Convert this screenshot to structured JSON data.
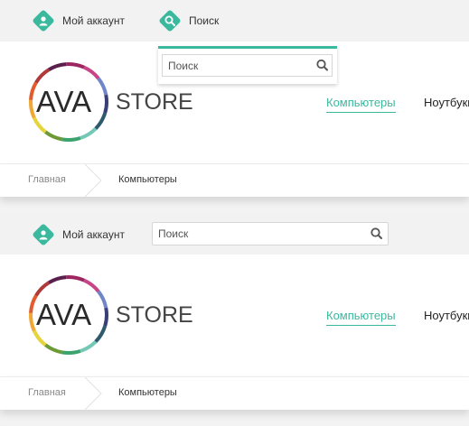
{
  "screens": [
    {
      "topbar": {
        "account_label": "Мой аккаунт",
        "search_label": "Поиск",
        "search_input": {
          "placeholder": "Поиск",
          "value": ""
        }
      },
      "logo": {
        "text": "AVA",
        "subtext": "STORE"
      },
      "nav": {
        "items": [
          "Компьютеры",
          "Ноутбуки"
        ],
        "active_index": 0
      },
      "breadcrumb": {
        "home": "Главная",
        "current": "Компьютеры"
      }
    },
    {
      "topbar": {
        "account_label": "Мой аккаунт",
        "search_input": {
          "placeholder": "Поиск",
          "value": ""
        }
      },
      "logo": {
        "text": "AVA",
        "subtext": "STORE"
      },
      "nav": {
        "items": [
          "Компьютеры",
          "Ноутбуки"
        ],
        "active_index": 0
      },
      "breadcrumb": {
        "home": "Главная",
        "current": "Компьютеры"
      }
    }
  ],
  "icons": {
    "account": "user-icon",
    "search": "search-icon",
    "search_button": "magnifier-icon"
  },
  "colors": {
    "accent": "#3bb99e",
    "topbar_bg": "#f2f2f2",
    "page_bg": "#f3f3f3",
    "muted_text": "#888888"
  }
}
